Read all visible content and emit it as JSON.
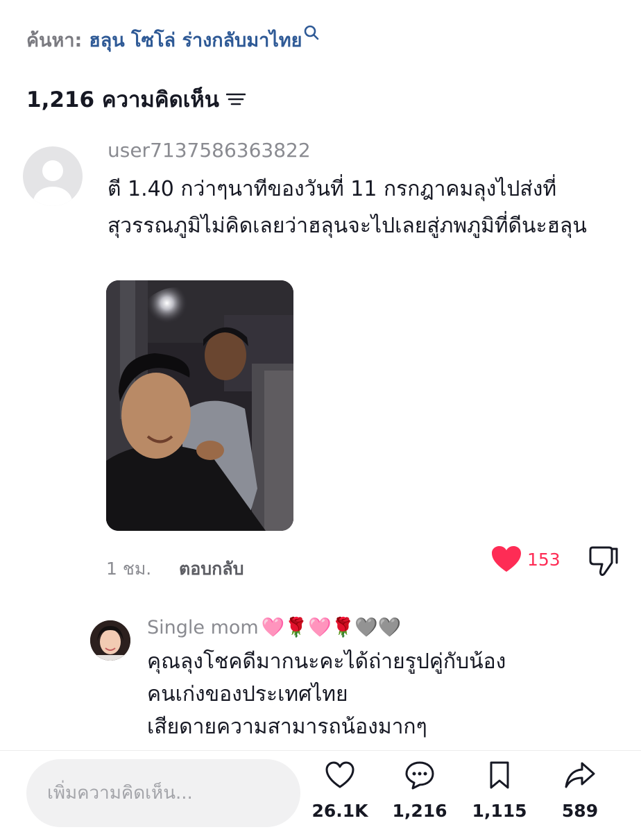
{
  "search": {
    "prefix": "ค้นหา:",
    "query": "ฮลุน โซโล่ ร่างกลับมาไทย"
  },
  "comments_count_label": "1,216 ความคิดเห็น",
  "comment1": {
    "username": "user7137586363822",
    "text": "ตี 1.40 กว่าๆนาทีของวันที่ 11 กรกฎาคมลุงไปส่งที่สุวรรณภูมิไม่คิดเลยว่าฮลุนจะไปเลยสู่ภพภูมิที่ดีนะฮลุน",
    "time": "1 ชม.",
    "reply_label": "ตอบกลับ",
    "likes": "153",
    "liked": true,
    "like_color": "#fe2c55"
  },
  "comment2": {
    "username": "Single  mom",
    "emoji": "🩷🌹🩷🌹🩶🩶",
    "line1": "คุณลุงโชคดีมากนะคะได้ถ่ายรูปคู่กับน้อง",
    "line2": "คนเก่งของประเทศไทย",
    "line3": "เสียดายความสามารถน้องมากๆ"
  },
  "bottom_bar": {
    "input_placeholder": "เพิ่มความคิดเห็น...",
    "likes": "26.1K",
    "comments": "1,216",
    "saves": "1,115",
    "shares": "589"
  }
}
